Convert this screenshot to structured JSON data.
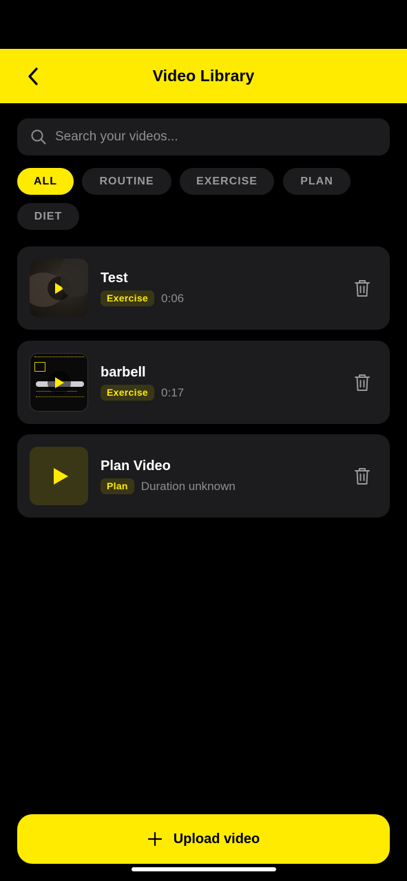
{
  "header": {
    "title": "Video Library"
  },
  "search": {
    "placeholder": "Search your videos..."
  },
  "filters": {
    "selected": "ALL",
    "items": [
      "ALL",
      "ROUTINE",
      "EXERCISE",
      "PLAN",
      "DIET"
    ]
  },
  "videos": [
    {
      "title": "Test",
      "tag": "Exercise",
      "duration": "0:06"
    },
    {
      "title": "barbell",
      "tag": "Exercise",
      "duration": "0:17"
    },
    {
      "title": "Plan Video",
      "tag": "Plan",
      "duration": "Duration unknown"
    }
  ],
  "upload": {
    "label": "Upload video"
  },
  "colors": {
    "accent": "#FFEB00",
    "card": "#1c1c1e",
    "background": "#000000",
    "badge_bg": "#3a3716",
    "muted": "#8e8e93"
  },
  "icons": [
    "chevron-left-icon",
    "search-icon",
    "play-icon",
    "trash-icon",
    "plus-icon"
  ]
}
